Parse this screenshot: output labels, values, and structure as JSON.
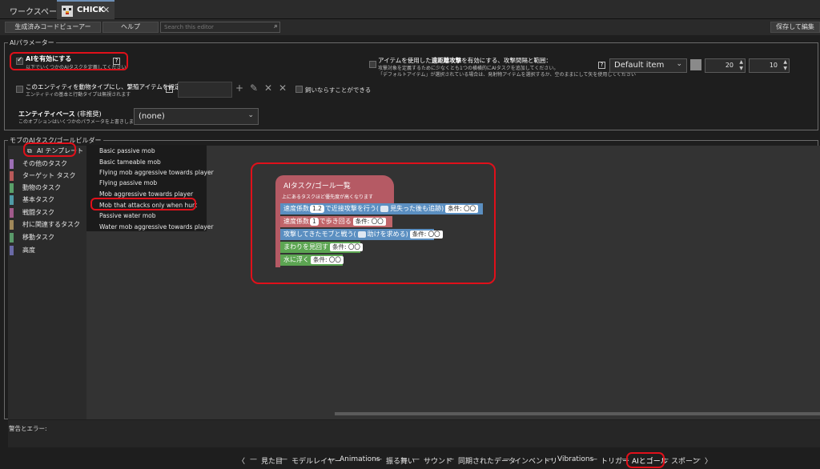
{
  "tabs": {
    "workspace": "ワークスペース",
    "mod": "CHICK",
    "close": "✕"
  },
  "toolbar": {
    "generated_code": "生成済みコードビューアー",
    "help": "ヘルプ",
    "search_placeholder": "Search this editor",
    "save": "保存して編集"
  },
  "ai_params": {
    "legend": "AIパラメーター",
    "enable_label": "AIを有効にする",
    "enable_sub": "以下でいくつかのAIタスクを定義してください",
    "enable_checked": true,
    "ranged_title_a": "アイテムを使用した",
    "ranged_title_b": "遠距離攻撃",
    "ranged_title_c": "を有効にする、攻撃間隔と範囲：",
    "ranged_sub1": "攻撃対象を定義するために少なくとも1つの横横的にAIタスクを追加してください。",
    "ranged_sub2": "「デフォルトアイテム」が選択されている場合は、発射物アイテムを選択するか、空のままにして矢を使用してください",
    "ranged_item": "Default item",
    "ranged_interval": "20",
    "ranged_range": "10",
    "breed_label": "このエンティティを動物タイプにし、繁殖アイテムを設定する：",
    "breed_sub": "エンティティの基本と行動タイプは無視されます",
    "tame_label": "飼いならすことができる",
    "base_label": "エンティティベース",
    "base_label_suffix": "(非推奨)",
    "base_sub": "このオプションはいくつかのパラメータを上書きします！",
    "base_value": "(none)",
    "help": "?"
  },
  "builder": {
    "legend": "モブのAIタスク/ゴールビルダー",
    "template_button": "AI テンプレート",
    "categories": [
      {
        "label": "その他のタスク",
        "color": "#9c6fb5"
      },
      {
        "label": "ターゲット タスク",
        "color": "#b85a5a"
      },
      {
        "label": "動物のタスク",
        "color": "#5aa06a"
      },
      {
        "label": "基本タスク",
        "color": "#4f9aa6"
      },
      {
        "label": "戦闘タスク",
        "color": "#a05a8a"
      },
      {
        "label": "村に関連するタスク",
        "color": "#a0885a"
      },
      {
        "label": "移動タスク",
        "color": "#5a9a6a"
      },
      {
        "label": "高度",
        "color": "#6a6aa6"
      }
    ],
    "templates": [
      "Basic passive mob",
      "Basic tameable mob",
      "Flying mob aggressive towards player",
      "Flying passive mob",
      "Mob aggressive towards player",
      "Mob that attacks only when hurt",
      "Passive water mob",
      "Water mob aggressive towards player"
    ],
    "goal_list_title": "AIタスク/ゴール一覧",
    "goal_list_sub": "上にあるタスクほど優先度が高くなります",
    "b1_a": "速度係数",
    "b1_v": "1.2",
    "b1_b": "で近接攻撃を行う(",
    "b1_c": "見失った後も追跡)",
    "b1_cond": "条件: 〇〇",
    "b2_a": "速度係数",
    "b2_v": "1",
    "b2_b": "で歩き回る",
    "b2_cond": "条件: 〇〇",
    "b3_a": "攻撃してきたモブと戦う(",
    "b3_b": "助けを求める)",
    "b3_cond": "条件: 〇〇",
    "b4_a": "まわりを見回す",
    "b4_cond": "条件: 〇〇",
    "b5_a": "水に浮く",
    "b5_cond": "条件: 〇〇"
  },
  "errors": {
    "label": "警告とエラー:"
  },
  "bottom_nav": {
    "prev": "〈",
    "next": "〉",
    "sep": "—",
    "items": [
      "見た目",
      "モデルレイヤー",
      "Animations",
      "振る舞い",
      "サウンド",
      "同期されたデータ",
      "インベントリ",
      "Vibrations",
      "トリガー",
      "AIとゴール",
      "スポーン"
    ]
  },
  "colors": {
    "accent_red": "#e0101a",
    "block_red": "#b55a64",
    "block_blue": "#5b8fc1",
    "block_green": "#5ca552",
    "block_rose": "#c0656a"
  }
}
